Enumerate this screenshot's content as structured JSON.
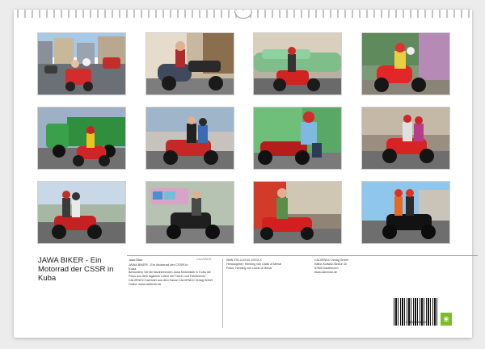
{
  "calendar": {
    "title": "JAWA BIKER - Ein Motorrad der CSSR in Kuba",
    "photos": [
      {
        "name": "photo-traffic-street"
      },
      {
        "name": "photo-black-sidecar"
      },
      {
        "name": "photo-green-car-red-bike"
      },
      {
        "name": "photo-rider-crowd"
      },
      {
        "name": "photo-green-truck"
      },
      {
        "name": "photo-couple-on-bike"
      },
      {
        "name": "photo-rider-green-wall"
      },
      {
        "name": "photo-two-riders"
      },
      {
        "name": "photo-group-on-bike"
      },
      {
        "name": "photo-graffiti-wall"
      },
      {
        "name": "photo-rider-parked"
      },
      {
        "name": "photo-blue-sky-street"
      }
    ],
    "info": {
      "col1_lines": [
        "Jawa Biker ",
        "JAWA BIKER - Ein Motorrad der CSSR in",
        "Kuba",
        "Bewundern Sie die faszinierenden Jawa Motorräder in Kuba mit",
        "Fotos aus dem täglichen Leben der Fahrer und Fahrerinnen.",
        "CALVENDO Kalender aus dem Hause CALVENDO Verlag GmbH.",
        "Online: www.calvendo.de"
      ],
      "ref": "CALVENDO",
      "col2_lines": [
        "ISBN 978-3-XXXX-XXXX-X",
        "Herausgeber: Henning von Löwis of Menar",
        "Fotos: Henning von Löwis of Menar"
      ],
      "col3_lines": [
        "CALVENDO Verlag GmbH",
        "Käthe-Kollwitz-Straße 33",
        "87600 Kaufbeuren",
        "www.calvendo.de"
      ],
      "barcode_number": "9 783000 000000"
    }
  }
}
